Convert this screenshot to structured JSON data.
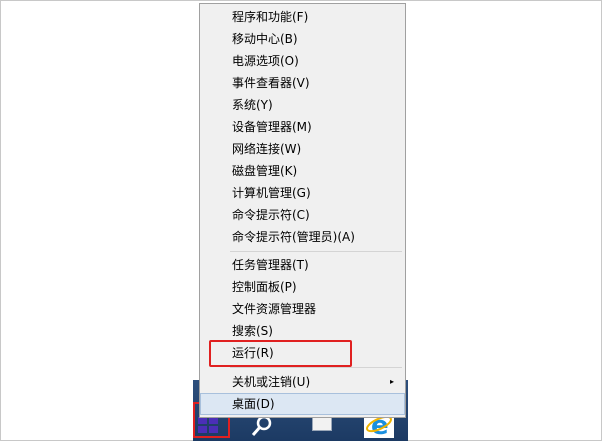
{
  "menu": {
    "groups": [
      {
        "items": [
          {
            "label": "程序和功能(F)"
          },
          {
            "label": "移动中心(B)"
          },
          {
            "label": "电源选项(O)"
          },
          {
            "label": "事件查看器(V)"
          },
          {
            "label": "系统(Y)"
          },
          {
            "label": "设备管理器(M)"
          },
          {
            "label": "网络连接(W)"
          },
          {
            "label": "磁盘管理(K)"
          },
          {
            "label": "计算机管理(G)"
          },
          {
            "label": "命令提示符(C)"
          },
          {
            "label": "命令提示符(管理员)(A)"
          }
        ]
      },
      {
        "items": [
          {
            "label": "任务管理器(T)"
          },
          {
            "label": "控制面板(P)"
          },
          {
            "label": "文件资源管理器"
          },
          {
            "label": "搜索(S)"
          },
          {
            "label": "运行(R)",
            "highlighted": true
          }
        ]
      },
      {
        "items": [
          {
            "label": "关机或注销(U)",
            "submenu_arrow": "▸"
          },
          {
            "label": "桌面(D)",
            "hovered": true
          }
        ]
      }
    ]
  },
  "taskbar": {
    "icons": [
      "windows-start-icon",
      "search-icon",
      "file-explorer-icon",
      "internet-explorer-icon"
    ],
    "start_highlighted": true
  },
  "colors": {
    "highlight_box": "#e02020",
    "menu_background": "#f0f0f0",
    "hover_background": "#dce7f3",
    "taskbar": "#1f3f6a"
  }
}
